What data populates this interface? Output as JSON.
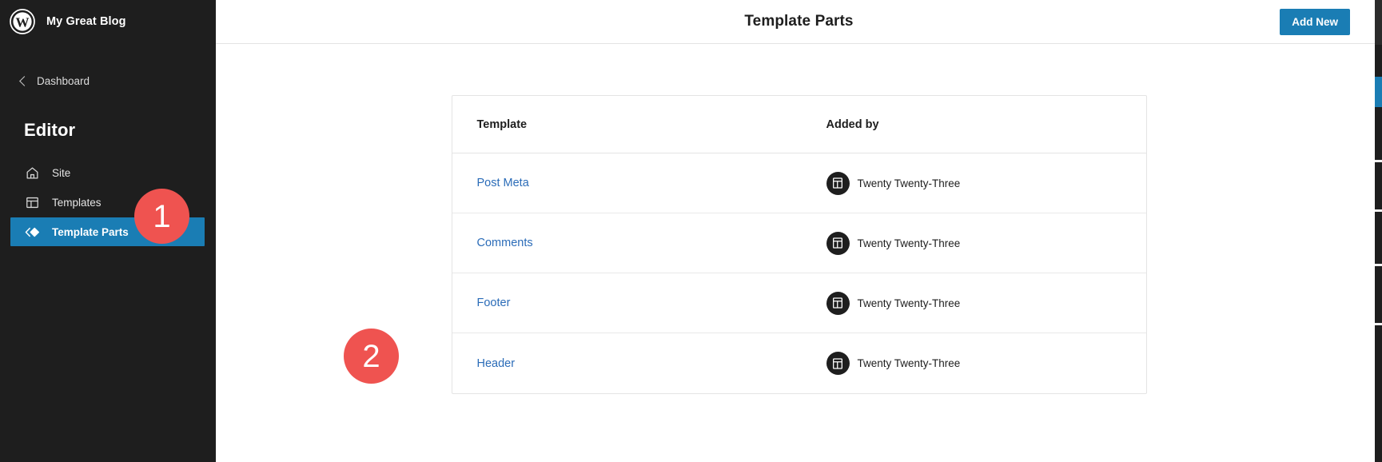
{
  "sidebar": {
    "logo_icon": "wordpress-logo-icon",
    "site_title": "My Great Blog",
    "back": {
      "icon": "chevron-left-icon",
      "label": "Dashboard"
    },
    "section_heading": "Editor",
    "items": [
      {
        "label": "Site",
        "icon": "home-icon",
        "active": false
      },
      {
        "label": "Templates",
        "icon": "layout-icon",
        "active": false
      },
      {
        "label": "Template Parts",
        "icon": "template-parts-icon",
        "active": true
      }
    ]
  },
  "topbar": {
    "title": "Template Parts",
    "add_new_label": "Add New"
  },
  "table": {
    "columns": [
      "Template",
      "Added by"
    ],
    "rows": [
      {
        "template": "Post Meta",
        "added_by": "Twenty Twenty-Three",
        "theme_icon": "theme-icon"
      },
      {
        "template": "Comments",
        "added_by": "Twenty Twenty-Three",
        "theme_icon": "theme-icon"
      },
      {
        "template": "Footer",
        "added_by": "Twenty Twenty-Three",
        "theme_icon": "theme-icon"
      },
      {
        "template": "Header",
        "added_by": "Twenty Twenty-Three",
        "theme_icon": "theme-icon"
      }
    ]
  },
  "callouts": [
    {
      "number": "1"
    },
    {
      "number": "2"
    }
  ],
  "colors": {
    "sidebar_background": "#1e1e1e",
    "accent_blue": "#1a7db4",
    "link_blue": "#2b6cb8",
    "callout_red": "#ef5350",
    "text_primary": "#1e1e1e",
    "border": "#e4e4e4"
  }
}
